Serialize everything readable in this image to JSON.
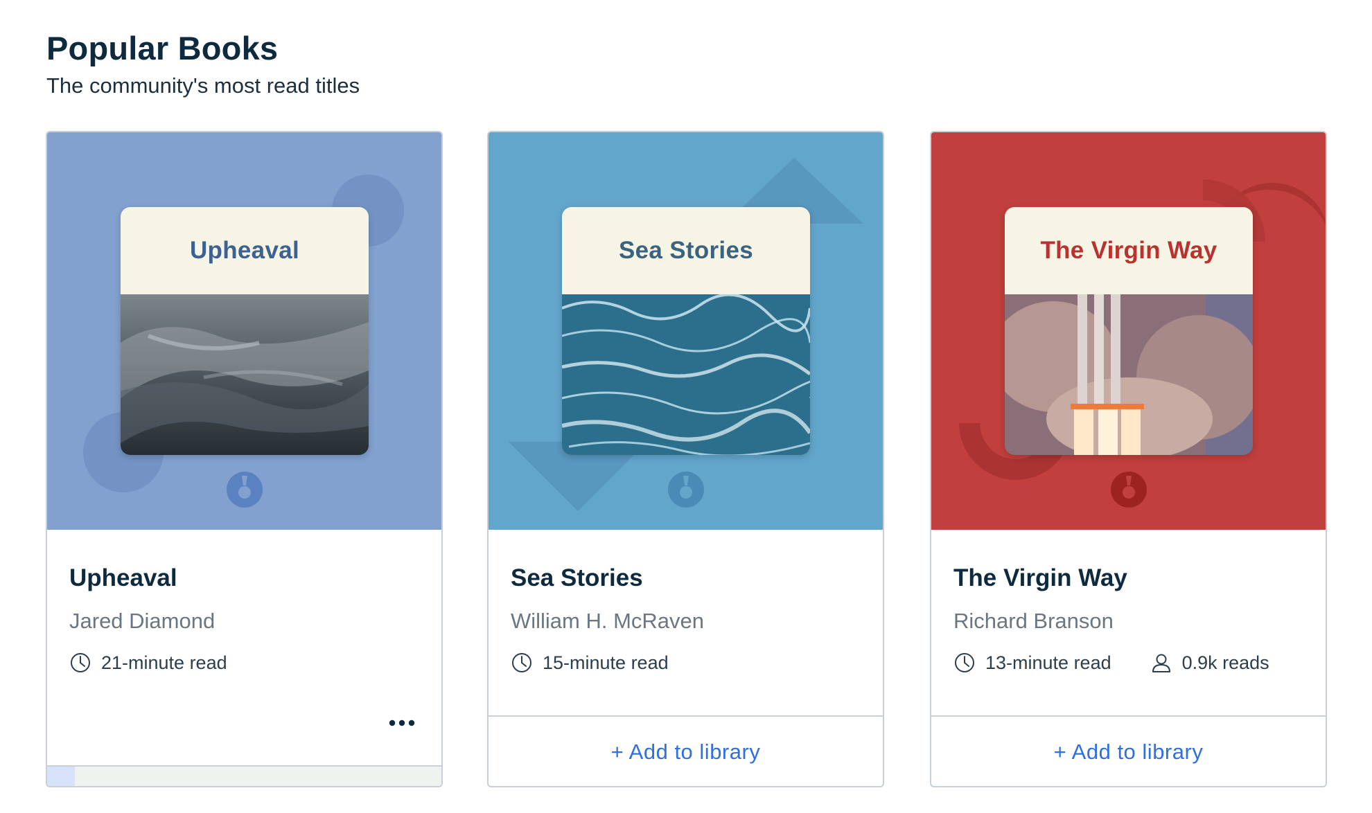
{
  "header": {
    "title": "Popular Books",
    "subtitle": "The community's most read titles"
  },
  "colors": {
    "card1_bg": "#82a1cf",
    "card2_bg": "#63a6cb",
    "card3_bg": "#c13f3d",
    "cover_band": "#f6f4e4",
    "title_dark": "#0e2a3f",
    "author_gray": "#6c7680",
    "link_blue": "#2f6fe0"
  },
  "books": [
    {
      "cover_title": "Upheaval",
      "title": "Upheaval",
      "author": "Jared Diamond",
      "read_time": "21-minute read",
      "progress": 0.07
    },
    {
      "cover_title": "Sea Stories",
      "title": "Sea Stories",
      "author": "William H. McRaven",
      "read_time": "15-minute read",
      "action": "+ Add to library"
    },
    {
      "cover_title": "The Virgin Way",
      "title": "The Virgin Way",
      "author": "Richard Branson",
      "read_time": "13-minute read",
      "reads": "0.9k reads",
      "action": "+ Add to library"
    }
  ],
  "icons": {
    "clock": "clock-icon",
    "user": "user-icon",
    "more": "more-options-icon",
    "brand": "blinkist-logo-icon"
  }
}
